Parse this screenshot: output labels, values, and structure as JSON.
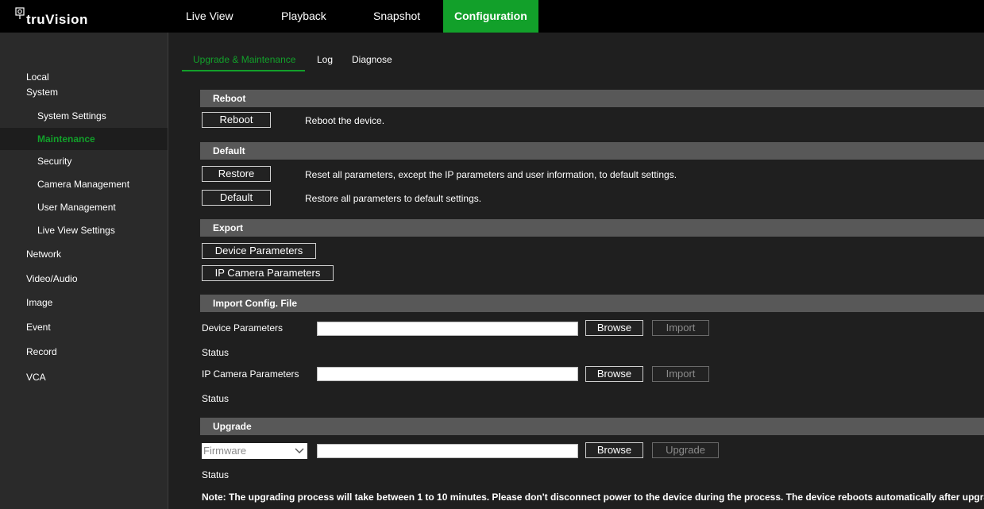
{
  "app": {
    "brand": "truVision",
    "logo_icon": "camera-logo-icon",
    "accent_color": "#12a02a"
  },
  "topnav": {
    "tabs": [
      {
        "label": "Live View",
        "active": false
      },
      {
        "label": "Playback",
        "active": false
      },
      {
        "label": "Snapshot",
        "active": false
      },
      {
        "label": "Configuration",
        "active": true
      }
    ]
  },
  "sidebar": {
    "items": [
      {
        "label": "Local",
        "level": 0,
        "active": false
      },
      {
        "label": "System",
        "level": 0,
        "active": false
      },
      {
        "label": "System Settings",
        "level": 1,
        "active": false
      },
      {
        "label": "Maintenance",
        "level": 1,
        "active": true
      },
      {
        "label": "Security",
        "level": 1,
        "active": false
      },
      {
        "label": "Camera Management",
        "level": 1,
        "active": false
      },
      {
        "label": "User Management",
        "level": 1,
        "active": false
      },
      {
        "label": "Live View Settings",
        "level": 1,
        "active": false
      },
      {
        "label": "Network",
        "level": 0,
        "active": false
      },
      {
        "label": "Video/Audio",
        "level": 0,
        "active": false
      },
      {
        "label": "Image",
        "level": 0,
        "active": false
      },
      {
        "label": "Event",
        "level": 0,
        "active": false
      },
      {
        "label": "Record",
        "level": 0,
        "active": false
      },
      {
        "label": "VCA",
        "level": 0,
        "active": false
      }
    ]
  },
  "subtabs": [
    {
      "label": "Upgrade & Maintenance",
      "active": true
    },
    {
      "label": "Log",
      "active": false
    },
    {
      "label": "Diagnose",
      "active": false
    }
  ],
  "reboot": {
    "header": "Reboot",
    "button": "Reboot",
    "description": "Reboot the device."
  },
  "default": {
    "header": "Default",
    "restore_button": "Restore",
    "restore_description": "Reset all parameters, except the IP parameters and user information, to default settings.",
    "default_button": "Default",
    "default_description": "Restore all parameters to default settings."
  },
  "export": {
    "header": "Export",
    "device_button": "Device Parameters",
    "ipcam_button": "IP Camera Parameters"
  },
  "import": {
    "header": "Import Config. File",
    "device_label": "Device Parameters",
    "device_file_value": "",
    "ipcam_label": "IP Camera Parameters",
    "ipcam_file_value": "",
    "browse_button": "Browse",
    "import_button": "Import",
    "status_label": "Status"
  },
  "upgrade": {
    "header": "Upgrade",
    "type_selected": "Firmware",
    "file_value": "",
    "browse_button": "Browse",
    "upgrade_button": "Upgrade",
    "status_label": "Status",
    "note": "Note: The upgrading process will take between 1 to 10 minutes. Please don't disconnect power to the device during the process. The device reboots automatically after upgrading."
  }
}
